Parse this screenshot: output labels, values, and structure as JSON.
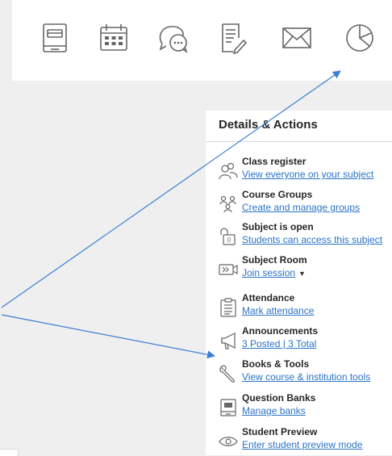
{
  "toolbar": {
    "icons": [
      {
        "name": "book",
        "label": ""
      },
      {
        "name": "calendar",
        "label": ""
      },
      {
        "name": "discussion",
        "label": ""
      },
      {
        "name": "assignment",
        "label": ""
      },
      {
        "name": "messages",
        "label": ""
      },
      {
        "name": "analytics",
        "label": ""
      }
    ]
  },
  "panel": {
    "title": "Details & Actions",
    "items": [
      {
        "title": "Class register",
        "link": "View everyone on your subject",
        "icon": "people-icon"
      },
      {
        "title": "Course Groups",
        "link": "Create and manage groups",
        "icon": "groups-icon"
      },
      {
        "title": "Subject is open",
        "link": "Students can access this subject",
        "icon": "lock-open-icon"
      },
      {
        "title": "Subject Room",
        "link": "Join session",
        "icon": "video-room-icon"
      },
      {
        "title": "Attendance",
        "link": "Mark attendance",
        "icon": "attendance-icon"
      },
      {
        "title": "Announcements",
        "link": "3 Posted | 3 Total",
        "icon": "megaphone-icon"
      },
      {
        "title": "Books & Tools",
        "link": "View course & institution tools",
        "icon": "wrench-icon"
      },
      {
        "title": "Question Banks",
        "link": "Manage banks",
        "icon": "question-bank-icon"
      },
      {
        "title": "Student Preview",
        "link": "Enter student preview mode",
        "icon": "eye-icon"
      }
    ]
  },
  "colors": {
    "link": "#2a73c5",
    "arrow": "#3b7fd4",
    "icon": "#666666"
  }
}
